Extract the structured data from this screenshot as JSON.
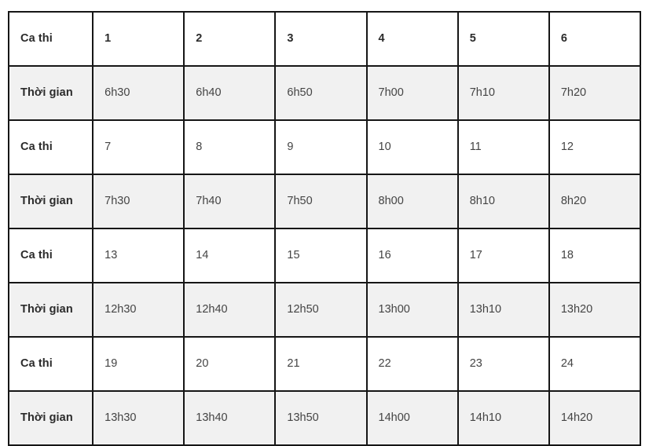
{
  "table": {
    "label_shift": "Ca thi",
    "label_time": "Thời gian",
    "colors": {
      "border": "#161616",
      "row_shaded_bg": "#f1f1f1",
      "row_plain_bg": "#ffffff",
      "label_text": "#2b2b2b",
      "data_text": "#444444"
    },
    "column_count": 7,
    "row_count": 8,
    "rows": [
      {
        "kind": "shift",
        "header": true,
        "label": "Ca thi",
        "cells": [
          "1",
          "2",
          "3",
          "4",
          "5",
          "6"
        ]
      },
      {
        "kind": "time",
        "header": false,
        "label": "Thời gian",
        "cells": [
          "6h30",
          "6h40",
          "6h50",
          "7h00",
          "7h10",
          "7h20"
        ]
      },
      {
        "kind": "shift",
        "header": false,
        "label": "Ca thi",
        "cells": [
          "7",
          "8",
          "9",
          "10",
          "11",
          "12"
        ]
      },
      {
        "kind": "time",
        "header": false,
        "label": "Thời gian",
        "cells": [
          "7h30",
          "7h40",
          "7h50",
          "8h00",
          "8h10",
          "8h20"
        ]
      },
      {
        "kind": "shift",
        "header": false,
        "label": "Ca thi",
        "cells": [
          "13",
          "14",
          "15",
          "16",
          "17",
          "18"
        ]
      },
      {
        "kind": "time",
        "header": false,
        "label": "Thời gian",
        "cells": [
          "12h30",
          "12h40",
          "12h50",
          "13h00",
          "13h10",
          "13h20"
        ]
      },
      {
        "kind": "shift",
        "header": false,
        "label": "Ca thi",
        "cells": [
          "19",
          "20",
          "21",
          "22",
          "23",
          "24"
        ]
      },
      {
        "kind": "time",
        "header": false,
        "label": "Thời gian",
        "cells": [
          "13h30",
          "13h40",
          "13h50",
          "14h00",
          "14h10",
          "14h20"
        ]
      }
    ]
  }
}
